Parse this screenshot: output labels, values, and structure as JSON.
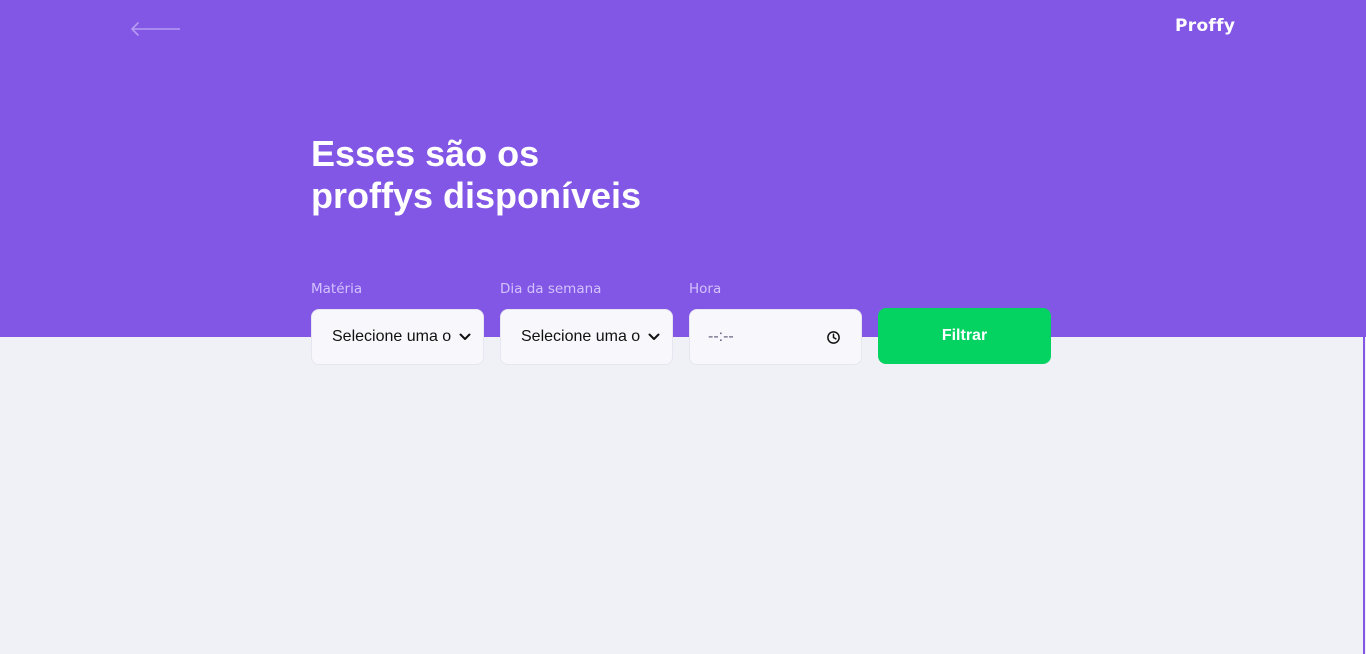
{
  "header": {
    "back_icon": "arrow-left-icon",
    "logo": "Proffy",
    "title_line1": "Esses são os",
    "title_line2": "proffys disponíveis"
  },
  "filters": {
    "subject": {
      "label": "Matéria",
      "value": "Selecione uma o"
    },
    "week_day": {
      "label": "Dia da semana",
      "value": "Selecione uma o"
    },
    "time": {
      "label": "Hora",
      "value": "--:--"
    },
    "submit_label": "Filtrar"
  },
  "colors": {
    "primary": "#8257E5",
    "secondary": "#04D361",
    "background": "#F0F0F7",
    "label": "#D4C2FF"
  }
}
